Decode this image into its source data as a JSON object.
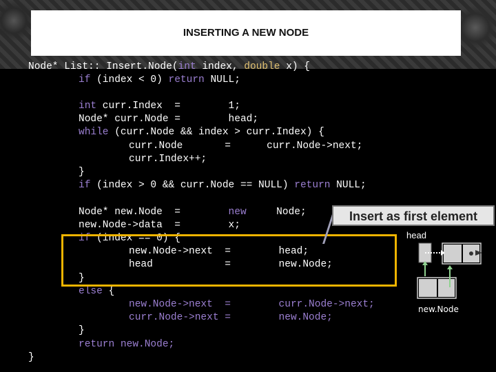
{
  "slide": {
    "title": "INSERTING A NEW NODE",
    "callout": "Insert as first element",
    "head_label": "head",
    "newnode_label": "new.Node"
  },
  "code": {
    "l1_a": "Node* List:: Insert.Node(",
    "l1_kw1": "int",
    "l1_b": " index, ",
    "l1_kw2": "double",
    "l1_c": " x) {",
    "l2_a": "if",
    "l2_b": " (index < 0) ",
    "l2_c": "return",
    "l2_d": " NULL;",
    "l3_a": "int",
    "l3_b": " curr.Index  =        1;",
    "l4": "Node* curr.Node =        head;",
    "l5_a": "while",
    "l5_b": " (curr.Node && index > curr.Index) {",
    "l6": "curr.Node       =      curr.Node->next;",
    "l7": "curr.Index++;",
    "l8": "}",
    "l9_a": "if",
    "l9_b": " (index > 0 && curr.Node == NULL) ",
    "l9_c": "return",
    "l9_d": " NULL;",
    "l10_a": "Node* new.Node  =        ",
    "l10_kw": "new",
    "l10_b": "     Node;",
    "l11": "new.Node->data  =        x;",
    "l12_a": "if",
    "l12_b": " (index == 0) {",
    "l13": "new.Node->next  =        head;",
    "l14": "head            =        new.Node;",
    "l15": "}",
    "l16_a": "else",
    "l16_b": " {",
    "l17": "new.Node->next  =        curr.Node->next;",
    "l18": "curr.Node->next =        new.Node;",
    "l19": "}",
    "l20_a": "return",
    "l20_b": " new.Node;",
    "l21": "}"
  },
  "colors": {
    "keyword": "#9b7fd1",
    "datatype": "#e0c070",
    "highlight": "#f0b400",
    "node_fill": "#d0d0d0",
    "arrow_green": "#8fd18f"
  }
}
